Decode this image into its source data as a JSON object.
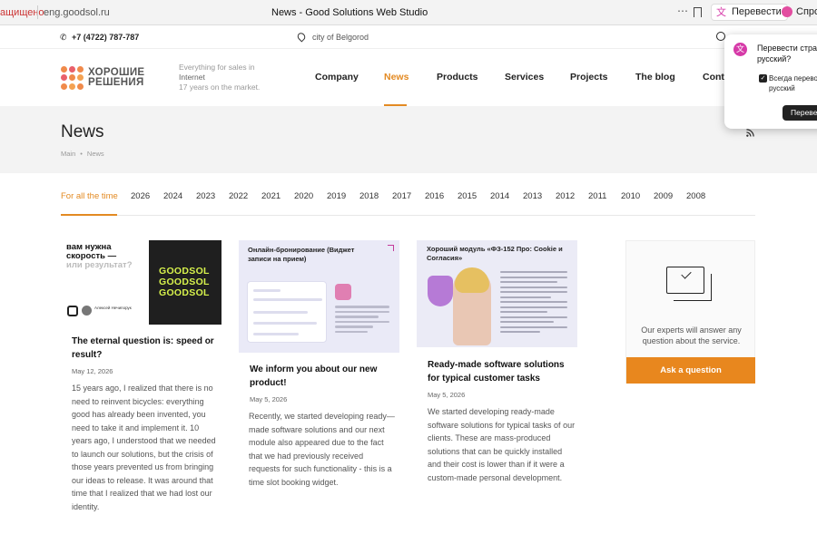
{
  "browser": {
    "insecure_label": "ащищено",
    "url": "eng.goodsol.ru",
    "tab_title": "News - Good Solutions Web Studio",
    "translate_button": "Перевести",
    "ask_button": "Спро"
  },
  "translate_popup": {
    "title": "Перевести стра на русский?",
    "always_label": "Всегда перево на русский",
    "action_button": "Переве"
  },
  "topbar": {
    "phone": "+7 (4722) 787-787",
    "city": "city of Belgorod"
  },
  "header": {
    "logo_line1": "ХОРОШИЕ",
    "logo_line2": "РЕШЕНИЯ",
    "tagline1": "Everything for sales in",
    "tagline2": "Internet",
    "tagline3": "17 years on the market."
  },
  "nav": {
    "items": [
      "Company",
      "News",
      "Products",
      "Services",
      "Projects",
      "The blog",
      "Conta"
    ]
  },
  "page": {
    "title": "News",
    "breadcrumb_main": "Main",
    "breadcrumb_current": "News"
  },
  "years": {
    "all": "For all the time",
    "list": [
      "2026",
      "2024",
      "2023",
      "2022",
      "2021",
      "2020",
      "2019",
      "2018",
      "2017",
      "2016",
      "2015",
      "2014",
      "2013",
      "2012",
      "2011",
      "2010",
      "2009",
      "2008"
    ]
  },
  "cards": [
    {
      "thumb_q1": "вам нужна",
      "thumb_q2": "скорость —",
      "thumb_q3": "или результат?",
      "thumb_brand": "GOODSOL",
      "thumb_name": "Алексей Нечипорук",
      "title": "The eternal question is: speed or result?",
      "date": "May 12, 2026",
      "text": "15 years ago, I realized that there is no need to reinvent bicycles: everything good has already been invented, you need to take it and implement it. 10 years ago, I understood that we needed to launch our solutions, but the crisis of those years prevented us from bringing our ideas to release. It was around that time that I realized that we had lost our identity."
    },
    {
      "thumb_heading": "Онлайн-бронирование (Виджет записи на прием)",
      "title": "We inform you about our new product!",
      "date": "May 5, 2026",
      "text": "Recently, we started developing ready—made software solutions and our next module also appeared due to the fact that we had previously received requests for such functionality - this is a time slot booking widget."
    },
    {
      "thumb_heading": "Хороший модуль «ФЗ-152 Про: Cookie и Согласия»",
      "title": "Ready-made software solutions for typical customer tasks",
      "date": "May 5, 2026",
      "text": "We started developing ready-made software solutions for typical tasks of our clients. These are mass-produced solutions that can be quickly installed and their cost is lower than if it were a custom-made personal development."
    }
  ],
  "widget": {
    "text": "Our experts will answer any question about the service.",
    "button": "Ask a question"
  },
  "colors": {
    "accent": "#e38a22",
    "button": "#e8871e",
    "band": "#f3f3f3"
  }
}
